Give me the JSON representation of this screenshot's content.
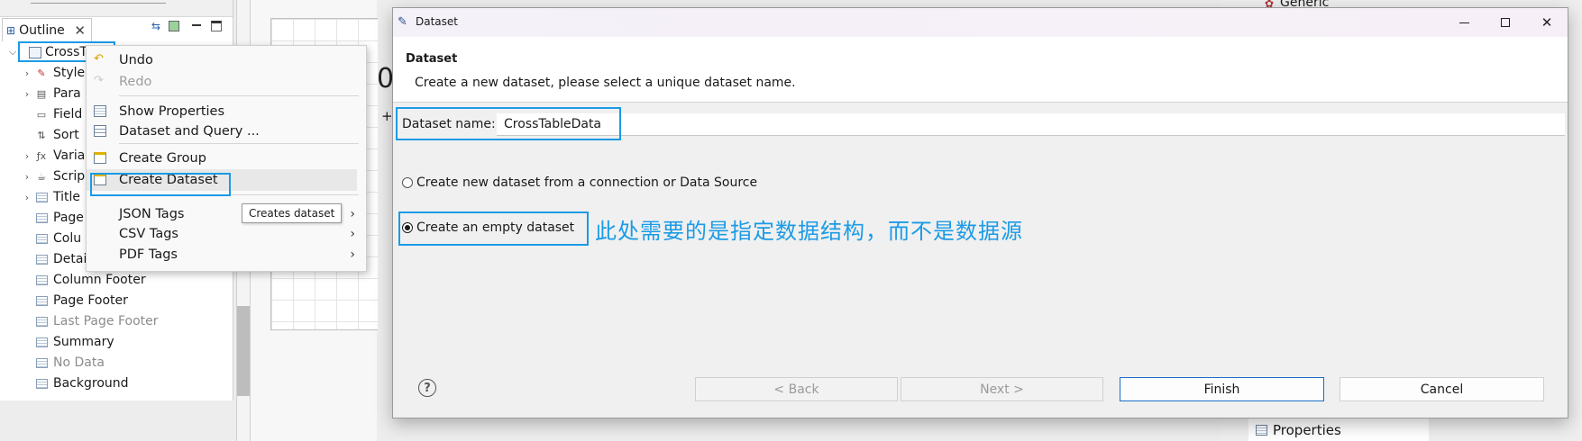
{
  "outline": {
    "tab_label": "Outline",
    "root_label": "CrossT",
    "items": [
      {
        "label": "Style",
        "icon": "style-brush-icon",
        "expandable": true,
        "dim": false
      },
      {
        "label": "Para",
        "icon": "parameter-icon",
        "expandable": true,
        "dim": false
      },
      {
        "label": "Field",
        "icon": "field-icon",
        "expandable": false,
        "dim": false
      },
      {
        "label": "Sort",
        "icon": "sort-icon",
        "expandable": false,
        "dim": false
      },
      {
        "label": "Varia",
        "icon": "variable-fx-icon",
        "expandable": true,
        "dim": false
      },
      {
        "label": "Scrip",
        "icon": "scriptlet-icon",
        "expandable": true,
        "dim": false
      },
      {
        "label": "Title",
        "icon": "band-icon",
        "expandable": true,
        "dim": false
      },
      {
        "label": "Page",
        "icon": "band-icon",
        "expandable": false,
        "dim": false
      },
      {
        "label": "Colu",
        "icon": "band-icon",
        "expandable": false,
        "dim": false
      },
      {
        "label": "Detai",
        "icon": "band-icon",
        "expandable": false,
        "dim": false
      },
      {
        "label": "Column Footer",
        "icon": "band-icon",
        "expandable": false,
        "dim": false
      },
      {
        "label": "Page Footer",
        "icon": "band-icon",
        "expandable": false,
        "dim": false
      },
      {
        "label": "Last Page Footer",
        "icon": "band-icon",
        "expandable": false,
        "dim": true
      },
      {
        "label": "Summary",
        "icon": "band-icon",
        "expandable": false,
        "dim": false
      },
      {
        "label": "No Data",
        "icon": "band-icon",
        "expandable": false,
        "dim": true
      },
      {
        "label": "Background",
        "icon": "band-icon",
        "expandable": false,
        "dim": false
      }
    ]
  },
  "canvas": {
    "zero": "0",
    "plus": "+"
  },
  "context_menu": {
    "undo": "Undo",
    "redo": "Redo",
    "show_properties": "Show Properties",
    "dataset_and_query": "Dataset and Query ...",
    "create_group": "Create Group",
    "create_dataset": "Create Dataset",
    "json_tags": "JSON Tags",
    "csv_tags": "CSV Tags",
    "pdf_tags": "PDF Tags",
    "tooltip": "Creates dataset"
  },
  "right_panel": {
    "generic": "Generic",
    "properties_tab": "Properties"
  },
  "dialog": {
    "window_title": "Dataset",
    "header_title": "Dataset",
    "header_description": "Create a new dataset, please select a unique dataset name.",
    "name_label": "Dataset name:",
    "name_value": "CrossTableData",
    "option_connection": "Create new dataset from a connection or Data Source",
    "option_empty": "Create an empty dataset",
    "selected_option": "empty",
    "annotation": "此处需要的是指定数据结构，而不是数据源",
    "help": "?",
    "buttons": {
      "back": "< Back",
      "next": "Next >",
      "finish": "Finish",
      "cancel": "Cancel"
    }
  },
  "colors": {
    "highlight": "#1b9be6",
    "annotation": "#1b9be6"
  }
}
